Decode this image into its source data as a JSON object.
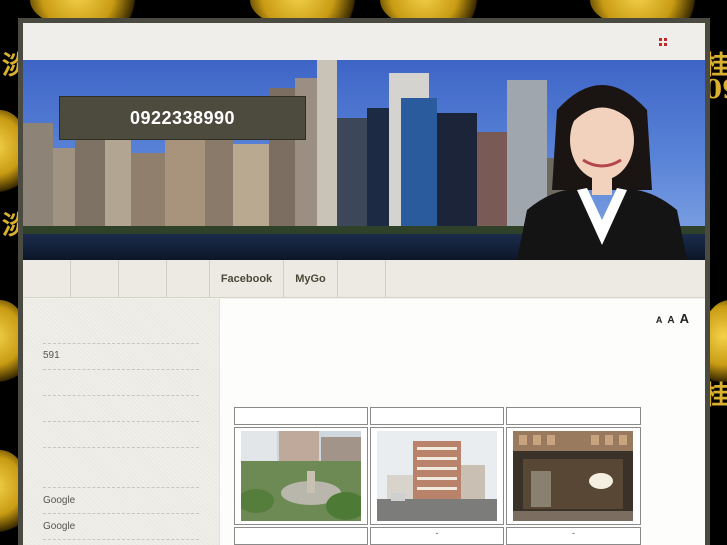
{
  "header": {
    "phone": "0922338990",
    "language_icon": "flag-icon"
  },
  "nav": {
    "items": [
      "",
      "",
      "",
      "",
      "Facebook",
      "MyGo",
      "",
      ""
    ]
  },
  "sidebar": {
    "items": [
      "591",
      "Google",
      "Google"
    ]
  },
  "font_size": {
    "small": "A",
    "medium": "A",
    "large": "A"
  },
  "gallery": {
    "captions": [
      "",
      "-",
      "-"
    ]
  },
  "background": {
    "glyphs": [
      "淡",
      "桂",
      "09",
      "淡",
      "桂"
    ]
  },
  "colors": {
    "page_bg": "#000000",
    "pattern": "#d9b030",
    "frame": "#4a4a40",
    "phone_box": "#4d4a3e",
    "nav_text": "#4a4a3a"
  }
}
